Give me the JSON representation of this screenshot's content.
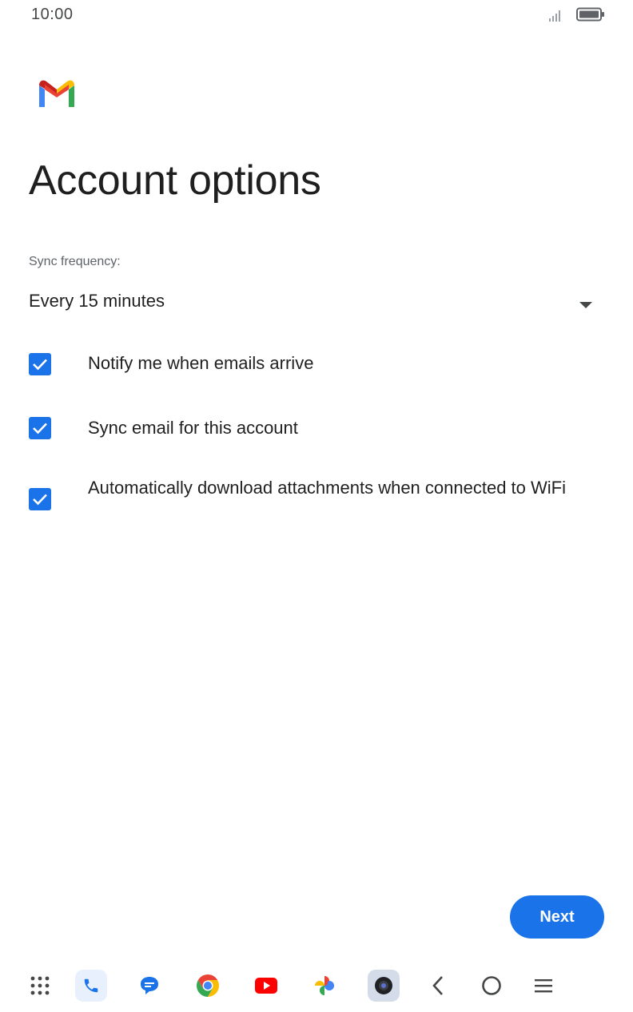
{
  "status_bar": {
    "time": "10:00",
    "signal_icon": "signal-icon",
    "battery_icon": "battery-icon"
  },
  "header": {
    "logo_icon": "gmail-logo-icon",
    "title": "Account options"
  },
  "sync": {
    "label": "Sync frequency:",
    "selected_value": "Every 15 minutes",
    "dropdown_icon": "arrow-drop-down-icon"
  },
  "options": [
    {
      "label": "Notify me when emails arrive",
      "checked": true
    },
    {
      "label": "Sync email for this account",
      "checked": true
    },
    {
      "label": "Automatically download attachments when connected to WiFi",
      "checked": true
    }
  ],
  "actions": {
    "next_label": "Next"
  },
  "taskbar": {
    "items": [
      "app-drawer-icon",
      "phone-icon",
      "messages-icon",
      "chrome-icon",
      "youtube-icon",
      "photos-icon",
      "camera-icon",
      "back-icon",
      "home-icon",
      "recents-icon"
    ]
  },
  "colors": {
    "accent": "#1a73e8",
    "text_primary": "#1f1f1f",
    "text_secondary": "#5f6368"
  }
}
